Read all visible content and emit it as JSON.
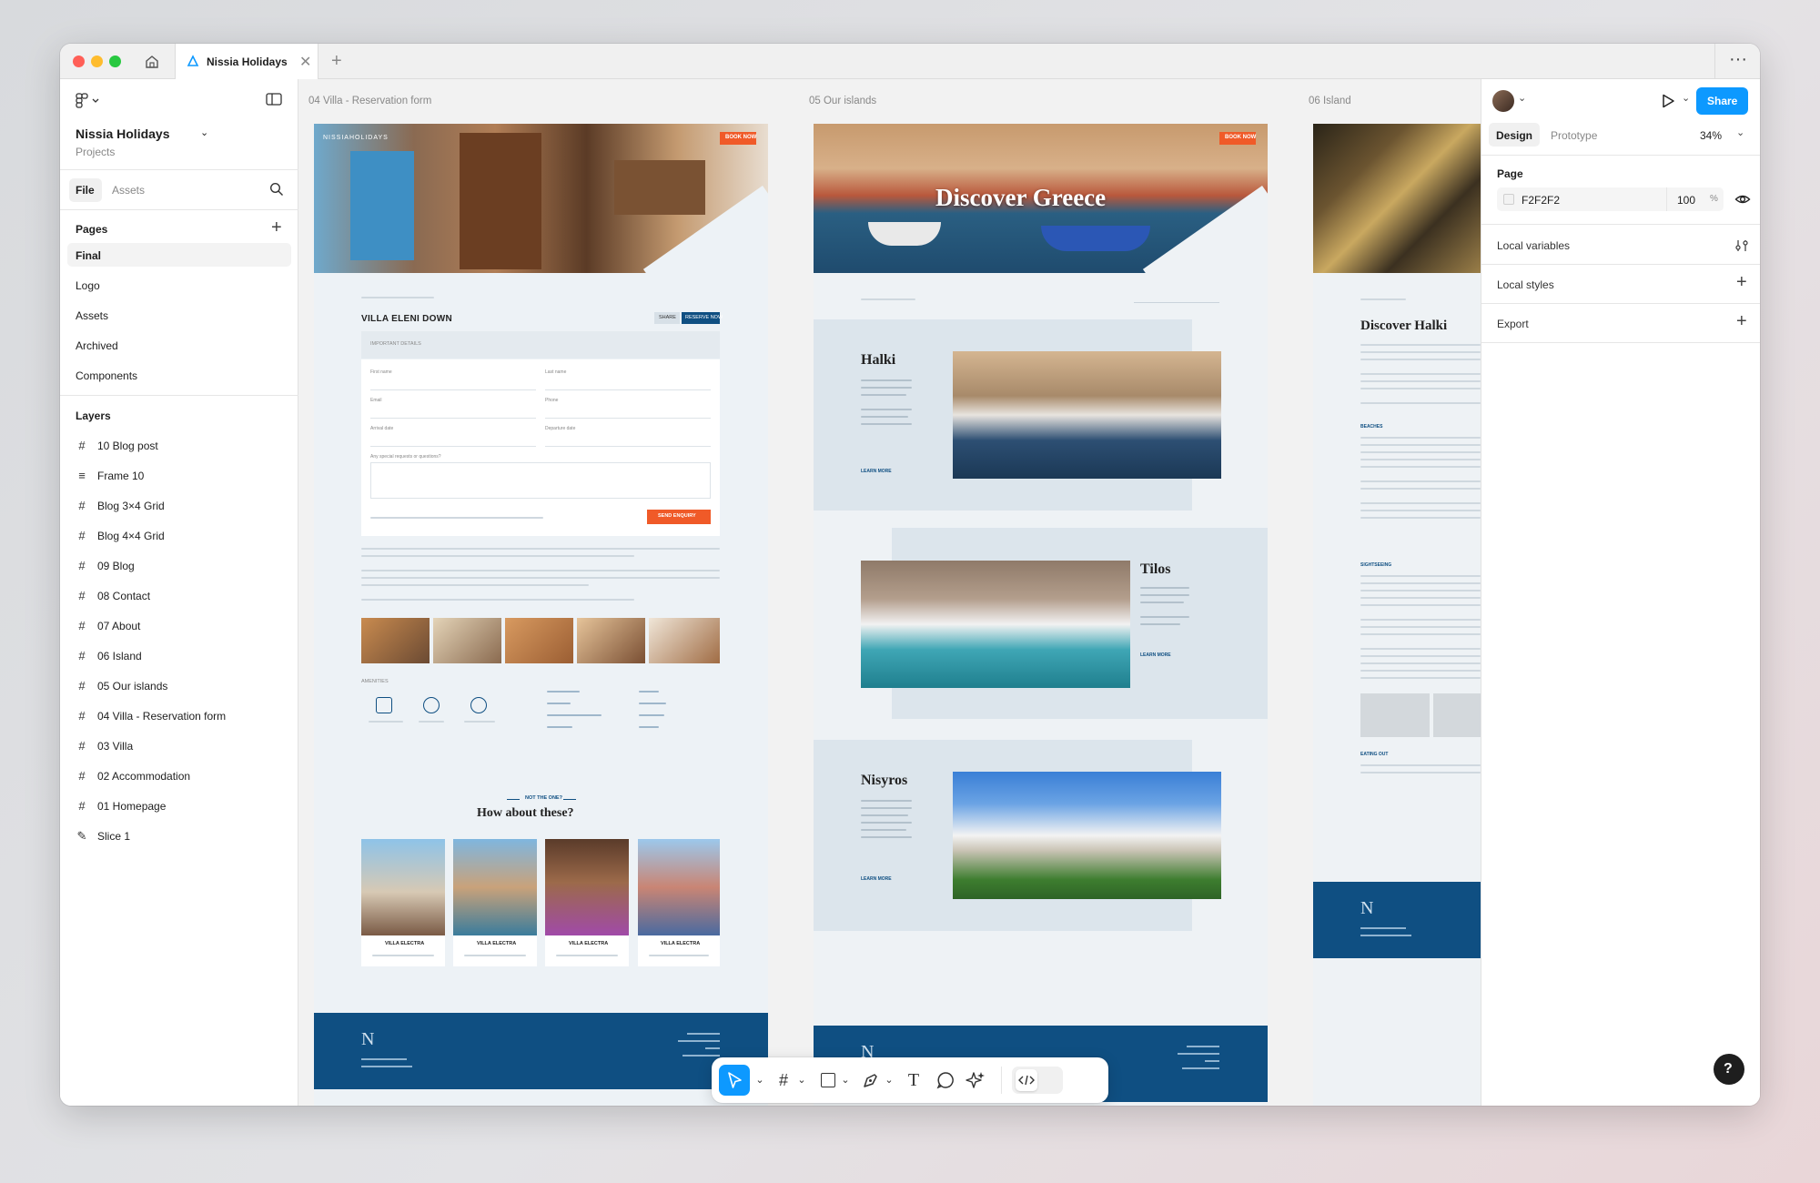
{
  "window": {
    "tab_title": "Nissia Holidays",
    "more": "···",
    "new_tab": "+"
  },
  "file": {
    "name": "Nissia Holidays",
    "location": "Projects"
  },
  "left_tabs": {
    "file": "File",
    "assets": "Assets"
  },
  "pages": {
    "title": "Pages",
    "items": [
      "Final",
      "Logo",
      "Assets",
      "Archived",
      "Components"
    ]
  },
  "layers": {
    "title": "Layers",
    "items": [
      {
        "icon": "#",
        "label": "10 Blog post"
      },
      {
        "icon": "≡",
        "label": "Frame 10"
      },
      {
        "icon": "#",
        "label": "Blog 3×4 Grid"
      },
      {
        "icon": "#",
        "label": "Blog 4×4 Grid"
      },
      {
        "icon": "#",
        "label": "09 Blog"
      },
      {
        "icon": "#",
        "label": "08 Contact"
      },
      {
        "icon": "#",
        "label": "07 About"
      },
      {
        "icon": "#",
        "label": "06 Island"
      },
      {
        "icon": "#",
        "label": "05 Our islands"
      },
      {
        "icon": "#",
        "label": "04 Villa - Reservation form"
      },
      {
        "icon": "#",
        "label": "03 Villa"
      },
      {
        "icon": "#",
        "label": "02 Accommodation"
      },
      {
        "icon": "#",
        "label": "01 Homepage"
      },
      {
        "icon": "✎",
        "label": "Slice 1"
      }
    ]
  },
  "right": {
    "share": "Share",
    "design_tab": "Design",
    "prototype_tab": "Prototype",
    "zoom": "34%",
    "page_label": "Page",
    "page_color": "F2F2F2",
    "page_opacity": "100",
    "percent": "%",
    "local_variables": "Local variables",
    "local_styles": "Local styles",
    "export": "Export",
    "help": "?"
  },
  "frames": {
    "f04": {
      "title": "04 Villa - Reservation form",
      "heading": "VILLA ELENI DOWN",
      "share_btn": "SHARE",
      "reserve_btn": "RESERVE NOW",
      "important": "IMPORTANT DETAILS",
      "fields": [
        "First name",
        "Last name",
        "Email",
        "Phone",
        "Arrival date",
        "Departure date",
        "Any special requests or questions?"
      ],
      "send_btn": "SEND ENQUIRY",
      "amenities_title": "AMENITIES",
      "not_the_one": "NOT THE ONE?",
      "how_about": "How about these?",
      "card_label": "VILLA ELECTRA",
      "nav_cta": "BOOK NOW",
      "brand": "NISSIAHOLIDAYS"
    },
    "f05": {
      "title": "05 Our islands",
      "hero": "Discover Greece",
      "islands": [
        "Halki",
        "Tilos",
        "Nisyros"
      ],
      "learn_more": "LEARN MORE",
      "nav_cta": "BOOK NOW"
    },
    "f06": {
      "title": "06 Island",
      "heading": "Discover Halki",
      "sections": [
        "BEACHES",
        "SIGHTSEEING",
        "EATING OUT"
      ]
    }
  },
  "colors": {
    "accent": "#0d99ff",
    "navy": "#0f4f82",
    "orange": "#f05a28"
  }
}
